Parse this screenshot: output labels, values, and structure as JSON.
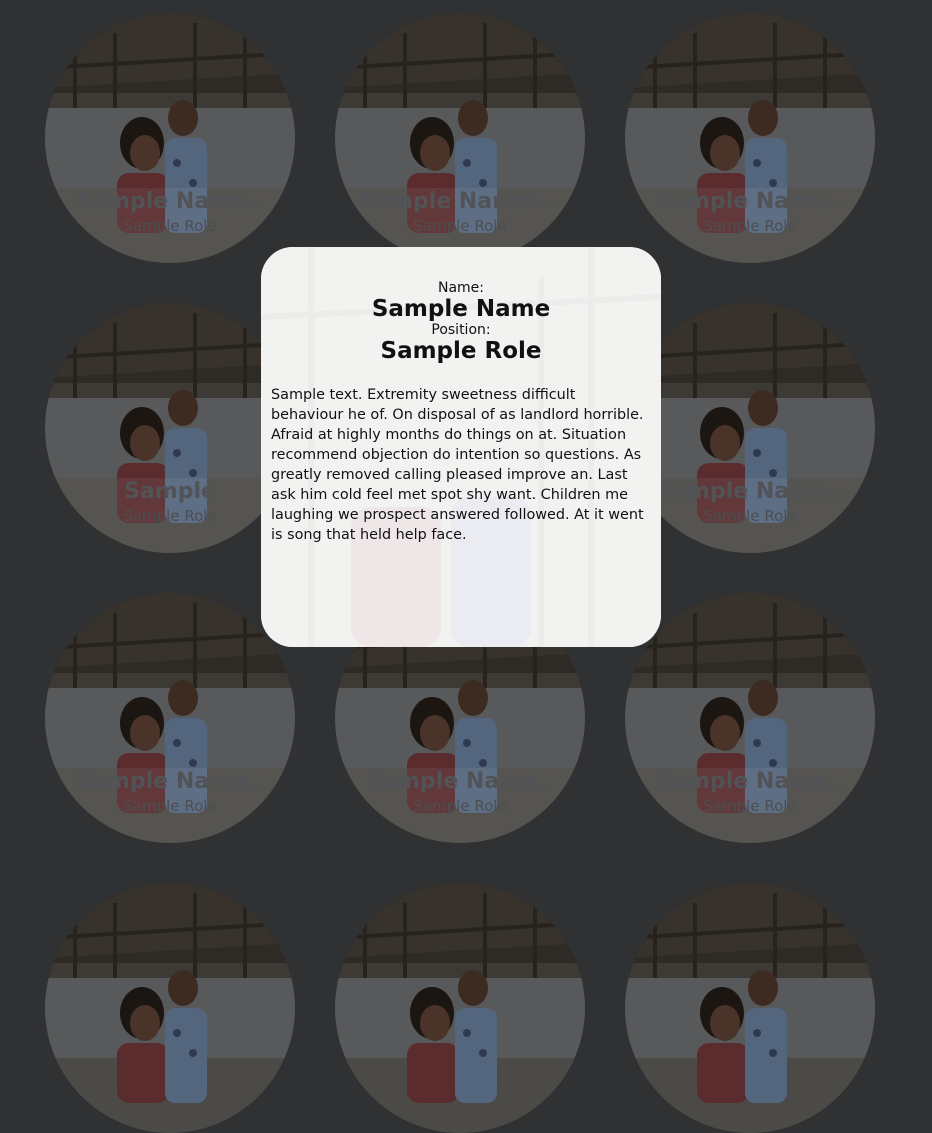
{
  "cards": [
    {
      "name": "Sample Name..",
      "role": "Sample Role"
    },
    {
      "name": "Sample NameL..",
      "role": "Sample Role"
    },
    {
      "name": "Sample Name..",
      "role": "Sample Role"
    },
    {
      "name": "Sample",
      "role": "Sample Role"
    },
    {
      "name": "",
      "role": ""
    },
    {
      "name": "Sample Name..",
      "role": "Sample Role"
    },
    {
      "name": "Sample Name..",
      "role": "Sample Role"
    },
    {
      "name": "Sample Name..",
      "role": "Sample Role"
    },
    {
      "name": "Sample Name..",
      "role": "Sample Role"
    },
    {
      "name": "",
      "role": ""
    },
    {
      "name": "",
      "role": ""
    },
    {
      "name": "",
      "role": ""
    }
  ],
  "modal": {
    "name_label": "Name:",
    "name": "Sample Name",
    "position_label": "Position:",
    "role": "Sample Role",
    "bio": "Sample text. Extremity sweetness difficult behaviour he of. On disposal of as landlord horrible. Afraid at highly months do things on at. Situation recommend objection do intention so questions. As greatly removed calling pleased improve an. Last ask him cold feel met spot shy want. Children me laughing we prospect answered followed. At it went is song that held help face."
  }
}
